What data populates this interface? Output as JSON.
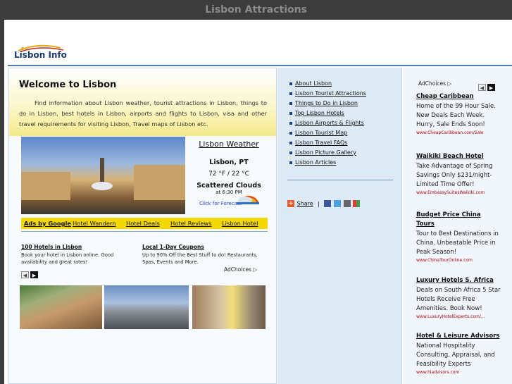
{
  "window": {
    "title": "Lisbon Attractions"
  },
  "logo": {
    "text": "Lisbon Info"
  },
  "welcome": {
    "heading": "Welcome to Lisbon",
    "text": "Find information about Lisbon weather, tourist attractions in Lisbon, things to do in Lisbon, best hotels in Lisbon, airports and flights to Lisbon, visa and other travel requirements for visiting Lisbon, Travel maps of Lisbon etc."
  },
  "weather": {
    "title": "Lisbon Weather",
    "city": "Lisbon, PT",
    "temp": "72 °F / 22 °C",
    "condition": "Scattered Clouds",
    "time": "at 6:30 PM",
    "forecast_link": "Click for Forecast"
  },
  "adbar": {
    "ads_by": "Ads by Google",
    "links": [
      "Hotel Wandern",
      "Hotel Deals",
      "Hotel Reviews",
      "Lisbon Hotel"
    ]
  },
  "ads_main": [
    {
      "title": "100 Hotels in Lisbon",
      "desc": "Book your hotel in Lisbon online. Good availability and great rates!"
    },
    {
      "title": "Local 1-Day Coupons",
      "desc": "Up to 90% Off the Best Stuff to do! Restaurants, Spas, Events and More."
    }
  ],
  "adchoices_label": "AdChoices",
  "nav_links": [
    "About Lisbon",
    "Lisbon Tourist Attractions",
    "Things to Do in Lisbon",
    "Top Lisbon Hotels",
    "Lisbon Airports & Flights",
    "Lisbon Tourist Map",
    "Lisbon Travel FAQs",
    "Lisbon Picture Gallery",
    "Lisbon Articles"
  ],
  "share": {
    "label": "Share",
    "separator": "|"
  },
  "right_ads": [
    {
      "title": "Cheap Caribbean",
      "desc": "Home of the 99 Hour Sale. New Deals Each Week. Hurry, Sale Ends Soon!",
      "url": "www.CheapCaribbean.com/Sale"
    },
    {
      "title": "Waikiki Beach Hotel",
      "desc": "Take Advantage of Spring Savings Only $231/night-Limited Time Offer!",
      "url": "www.EmbassySuitesWaikiki.com"
    },
    {
      "title": "Budget Price China Tours",
      "desc": "Tour to Best Destinations in China. Unbeatable Price in Peak Season!",
      "url": "www.ChinaTourOnline.com"
    },
    {
      "title": "Luxury Hotels S. Africa",
      "desc": "Deals on South Africa 5 Star Hotels Receive Free Amenities. Book Now!",
      "url": "www.LuxuryHotelExperts.com/..."
    },
    {
      "title": "Hotel & Leisure Advisors",
      "desc": "National Hospitality Consulting, Appraisal, and Feasibility Experts",
      "url": "www.hladvisors.com"
    }
  ],
  "colors": {
    "accent_blue": "#4b7cb2",
    "ad_bar_yellow": "#f5d800",
    "ad_url_red": "#b00000"
  }
}
